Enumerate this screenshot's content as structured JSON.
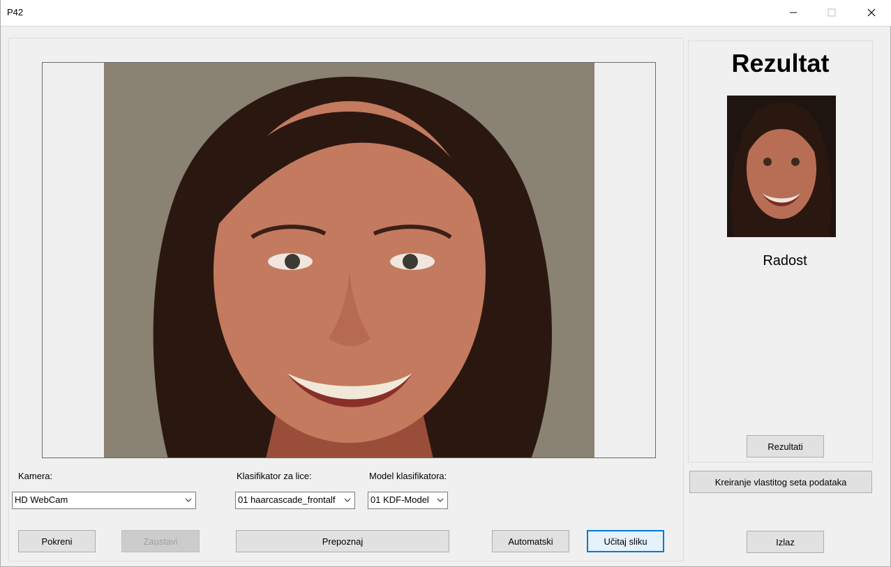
{
  "window": {
    "title": "P42",
    "minimize_icon": "minimize-icon",
    "maximize_icon": "maximize-icon",
    "close_icon": "close-icon"
  },
  "camera": {
    "label": "Kamera:",
    "selected": "HD WebCam"
  },
  "face_classifier": {
    "label": "Klasifikator za lice:",
    "selected": "01 haarcascade_frontalf"
  },
  "classifier_model": {
    "label": "Model klasifikatora:",
    "selected": "01 KDF-Model"
  },
  "buttons": {
    "start": "Pokreni",
    "stop": "Zaustavi",
    "recognize": "Prepoznaj",
    "automatic": "Automatski",
    "load_image": "Učitaj sliku",
    "results": "Rezultati",
    "create_dataset": "Kreiranje vlastitog seta podataka",
    "exit": "Izlaz"
  },
  "result": {
    "title": "Rezultat",
    "emotion": "Radost"
  },
  "colors": {
    "accent": "#0078d7",
    "background": "#f0f0f0",
    "photo_backdrop": "#8a8272",
    "skin": "#c47a5e",
    "hair": "#2a1810"
  }
}
